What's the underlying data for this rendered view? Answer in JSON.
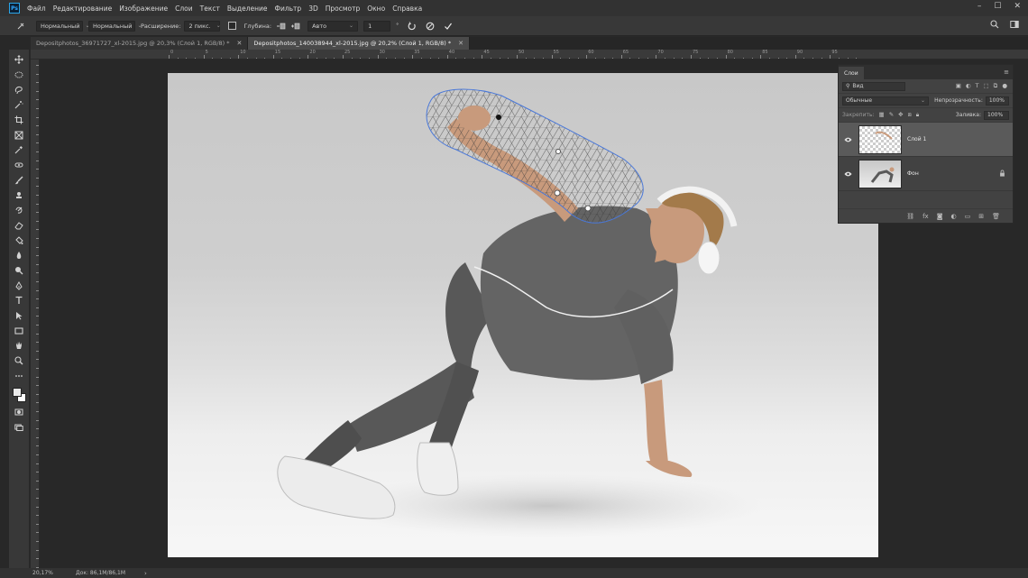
{
  "app": {
    "logo": "Ps"
  },
  "menubar": {
    "items": [
      "Файл",
      "Редактирование",
      "Изображение",
      "Слои",
      "Текст",
      "Выделение",
      "Фильтр",
      "3D",
      "Просмотр",
      "Окно",
      "Справка"
    ],
    "minimize": "–",
    "restore": "☐",
    "close": "✕"
  },
  "options": {
    "mode1": "Нормальный",
    "mode2": "Нормальный",
    "expansion_label": "Расширение:",
    "expansion_value": "2 пикс.",
    "depth_label": "Глубина:",
    "auto_value": "Авто",
    "num_value": "1"
  },
  "tabs": [
    {
      "label": "Depositphotos_36971727_xl-2015.jpg @ 20,3% (Слой 1, RGB/8) *",
      "close": "✕"
    },
    {
      "label": "Depositphotos_140038944_xl-2015.jpg @ 20,2% (Слой 1, RGB/8) *",
      "close": "✕"
    }
  ],
  "rulers": {
    "top_labels": [
      "0",
      "5",
      "10",
      "15",
      "20",
      "25",
      "30",
      "35",
      "40",
      "45",
      "50",
      "55",
      "60",
      "65",
      "70",
      "75",
      "80",
      "85",
      "90",
      "95"
    ]
  },
  "layers_panel": {
    "tab": "Слои",
    "search_label": "Вид",
    "blend_mode": "Обычные",
    "opacity_label": "Непрозрачность:",
    "opacity_value": "100%",
    "lock_label": "Закрепить:",
    "fill_label": "Заливка:",
    "fill_value": "100%",
    "layers": [
      {
        "name": "Слой 1",
        "selected": true
      },
      {
        "name": "Фон",
        "selected": false
      }
    ]
  },
  "status": {
    "zoom": "20,17%",
    "doc": "Док: 86,1М/86,1М",
    "arrow": "›"
  },
  "colors": {
    "accent": "#31a8ff",
    "panel": "#424242",
    "selected_layer": "#5a5a5a"
  }
}
